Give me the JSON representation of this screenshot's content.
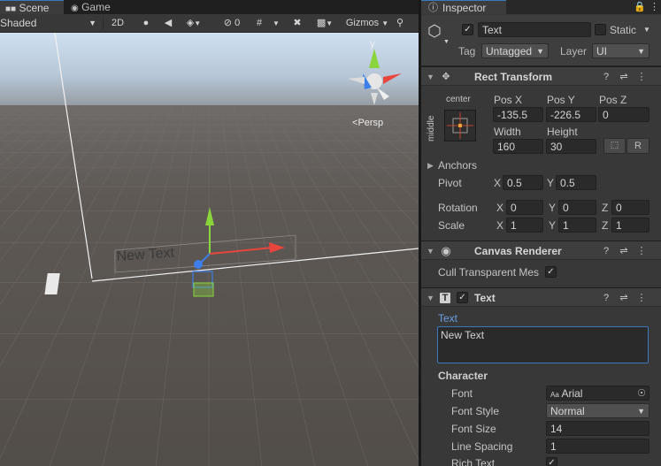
{
  "scene_tabs": {
    "scene": "Scene",
    "game": "Game"
  },
  "scene_toolbar": {
    "draw_mode": "Shaded",
    "mode_2d": "2D",
    "hidden_count": "0",
    "gizmos": "Gizmos"
  },
  "viewport": {
    "persp_label": "Persp",
    "axis_y": "y",
    "object_text": "New Text"
  },
  "inspector": {
    "tab_label": "Inspector",
    "object": {
      "name": "Text",
      "active": true,
      "static_label": "Static",
      "tag_label": "Tag",
      "tag_value": "Untagged",
      "layer_label": "Layer",
      "layer_value": "UI"
    },
    "rect_transform": {
      "title": "Rect Transform",
      "anchor_h": "center",
      "anchor_v": "middle",
      "pos_x_label": "Pos X",
      "pos_y_label": "Pos Y",
      "pos_z_label": "Pos Z",
      "pos_x": "-135.5",
      "pos_y": "-226.5",
      "pos_z": "0",
      "width_label": "Width",
      "height_label": "Height",
      "width": "160",
      "height": "30",
      "r_label": "R",
      "anchors_label": "Anchors",
      "pivot_label": "Pivot",
      "pivot_x_label": "X",
      "pivot_y_label": "Y",
      "pivot_x": "0.5",
      "pivot_y": "0.5",
      "rotation_label": "Rotation",
      "rot_x": "0",
      "rot_y": "0",
      "rot_z": "0",
      "scale_label": "Scale",
      "scale_x": "1",
      "scale_y": "1",
      "scale_z": "1",
      "x_label": "X",
      "y_label": "Y",
      "z_label": "Z"
    },
    "canvas_renderer": {
      "title": "Canvas Renderer",
      "cull_label": "Cull Transparent Mes",
      "cull_checked": true
    },
    "text_component": {
      "title": "Text",
      "enabled": true,
      "text_label": "Text",
      "text_value": "New Text",
      "character_label": "Character",
      "font_label": "Font",
      "font_value": "Arial",
      "font_prefix": "Aa",
      "font_style_label": "Font Style",
      "font_style_value": "Normal",
      "font_size_label": "Font Size",
      "font_size_value": "14",
      "line_spacing_label": "Line Spacing",
      "line_spacing_value": "1",
      "rich_text_label": "Rich Text",
      "rich_text_checked": true
    }
  },
  "colors": {
    "accent_blue": "#3a79bb",
    "text_label_blue": "#6b9ee0",
    "axis_x": "#e8453c",
    "axis_y": "#8ad43c",
    "axis_z": "#3e7ee8"
  }
}
